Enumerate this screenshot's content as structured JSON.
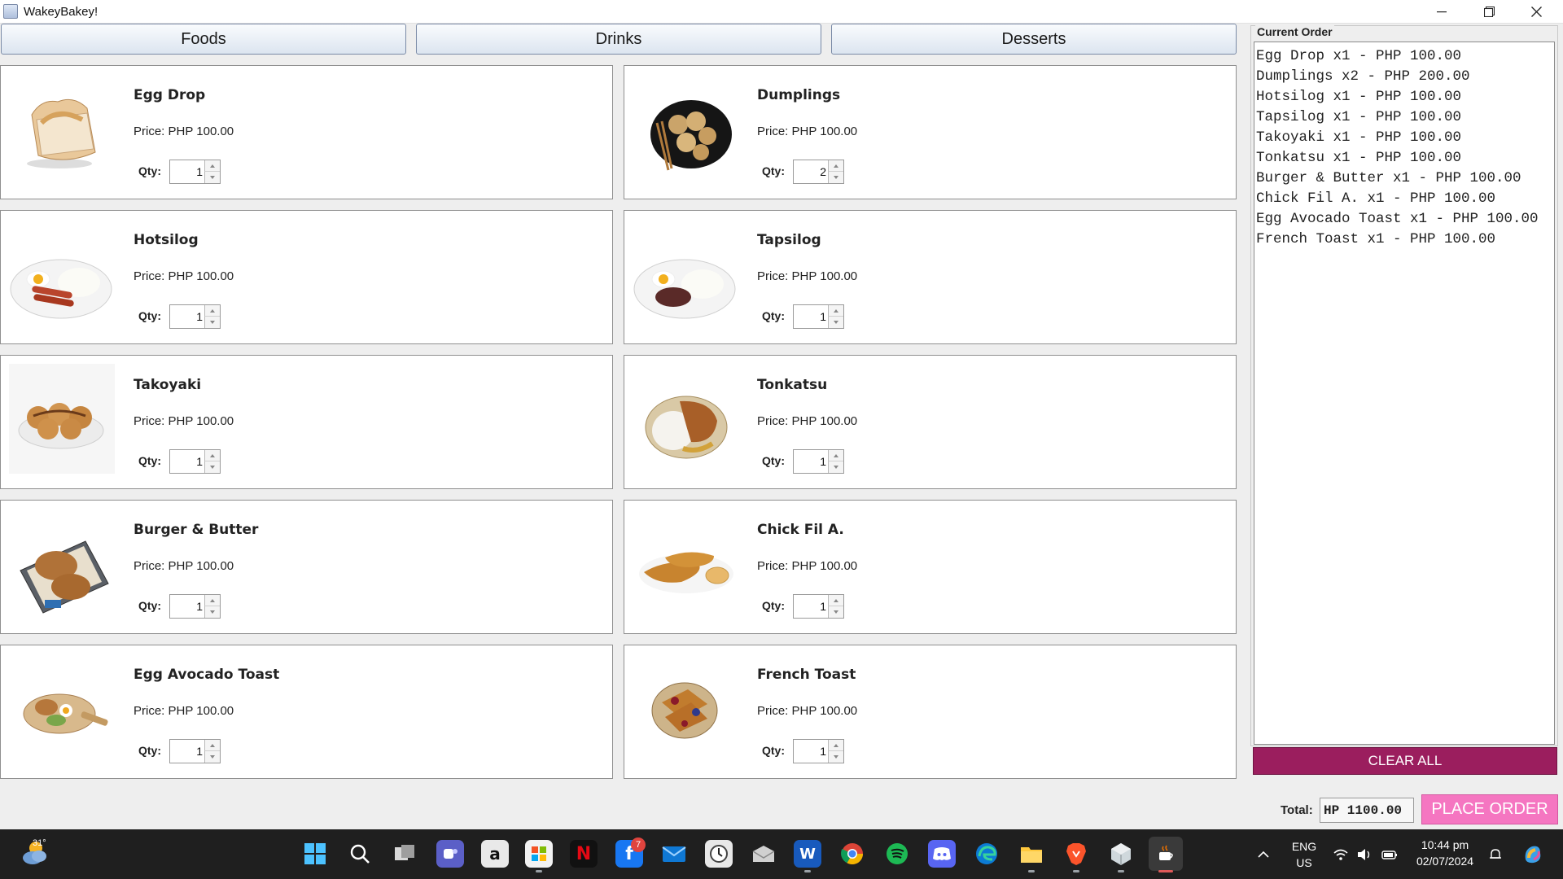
{
  "window": {
    "title": "WakeyBakey!"
  },
  "categories": [
    "Foods",
    "Drinks",
    "Desserts"
  ],
  "labels": {
    "price_prefix": "Price: ",
    "qty": "Qty:"
  },
  "foods": [
    {
      "name": "Egg Drop",
      "price": "PHP 100.00",
      "qty": "1",
      "icon": "egg-drop-sandwich-image"
    },
    {
      "name": "Dumplings",
      "price": "PHP 100.00",
      "qty": "2",
      "icon": "dumplings-plate-image"
    },
    {
      "name": "Hotsilog",
      "price": "PHP 100.00",
      "qty": "1",
      "icon": "hotsilog-plate-image"
    },
    {
      "name": "Tapsilog",
      "price": "PHP 100.00",
      "qty": "1",
      "icon": "tapsilog-plate-image"
    },
    {
      "name": "Takoyaki",
      "price": "PHP 100.00",
      "qty": "1",
      "icon": "takoyaki-plate-image"
    },
    {
      "name": "Tonkatsu",
      "price": "PHP 100.00",
      "qty": "1",
      "icon": "tonkatsu-plate-image"
    },
    {
      "name": "Burger & Butter",
      "price": "PHP 100.00",
      "qty": "1",
      "icon": "burger-tray-image"
    },
    {
      "name": "Chick Fil A.",
      "price": "PHP 100.00",
      "qty": "1",
      "icon": "chicken-tenders-image"
    },
    {
      "name": "Egg Avocado Toast",
      "price": "PHP 100.00",
      "qty": "1",
      "icon": "avocado-toast-image"
    },
    {
      "name": "French Toast",
      "price": "PHP 100.00",
      "qty": "1",
      "icon": "french-toast-image"
    }
  ],
  "order": {
    "title": "Current Order",
    "lines": [
      "Egg Drop x1 - PHP 100.00",
      "Dumplings x2 - PHP 200.00",
      "Hotsilog x1 - PHP 100.00",
      "Tapsilog x1 - PHP 100.00",
      "Takoyaki x1 - PHP 100.00",
      "Tonkatsu x1 - PHP 100.00",
      "Burger & Butter x1 - PHP 100.00",
      "Chick Fil A. x1 - PHP 100.00",
      "Egg Avocado Toast x1 - PHP 100.00",
      "French Toast x1 - PHP 100.00"
    ],
    "clear_label": "CLEAR ALL",
    "total_label": "Total:",
    "total_value": "HP 1100.00",
    "place_label": "PLACE ORDER"
  },
  "colors": {
    "clear_button": "#9b1e5e",
    "place_button": "#f576c1",
    "taskbar": "#1f1f1f"
  },
  "taskbar": {
    "weather_temp": "31°",
    "apps": [
      "windows-start-icon",
      "search-icon",
      "task-view-icon",
      "teams-chat-icon",
      "amazon-icon",
      "microsoft-store-icon",
      "netflix-icon",
      "facebook-icon",
      "mail-icon",
      "clock-app-icon",
      "mail-client-icon",
      "word-icon",
      "chrome-icon",
      "spotify-icon",
      "discord-icon",
      "edge-icon",
      "file-explorer-icon",
      "brave-icon",
      "app-cube-icon",
      "java-app-icon"
    ],
    "facebook_badge": "7",
    "lang_top": "ENG",
    "lang_bottom": "US",
    "time": "10:44 pm",
    "date": "02/07/2024"
  }
}
